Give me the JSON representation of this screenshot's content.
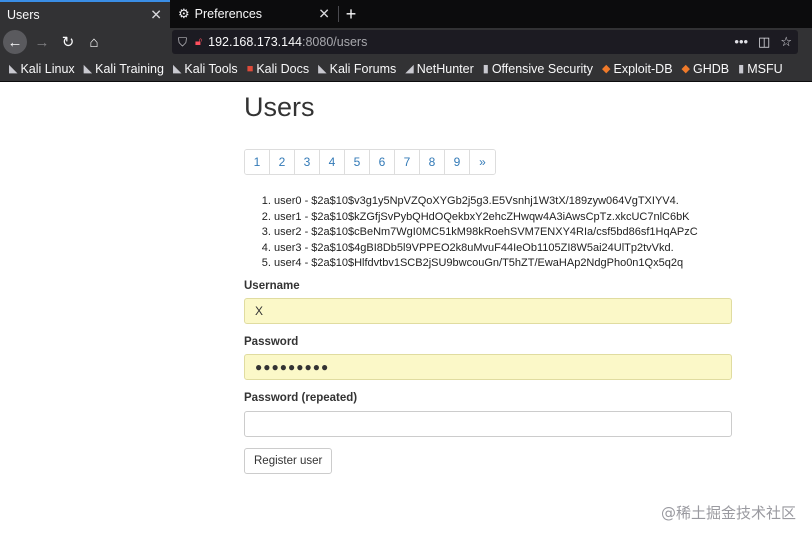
{
  "tabs": [
    {
      "title": "Users",
      "active": true
    },
    {
      "title": "Preferences",
      "active": false
    }
  ],
  "new_tab_label": "+",
  "url": {
    "host": "192.168.173.144",
    "rest": ":8080/users"
  },
  "bookmarks": [
    "Kali Linux",
    "Kali Training",
    "Kali Tools",
    "Kali Docs",
    "Kali Forums",
    "NetHunter",
    "Offensive Security",
    "Exploit-DB",
    "GHDB",
    "MSFU"
  ],
  "page": {
    "title": "Users",
    "pagination": [
      "1",
      "2",
      "3",
      "4",
      "5",
      "6",
      "7",
      "8",
      "9",
      "»"
    ],
    "users": [
      "user0 - $2a$10$v3g1y5NpVZQoXYGb2j5g3.E5Vsnhj1W3tX/189zyw064VgTXIYV4.",
      "user1 - $2a$10$kZGfjSvPybQHdOQekbxY2ehcZHwqw4A3iAwsCpTz.xkcUC7nlC6bK",
      "user2 - $2a$10$cBeNm7WgI0MC51kM98kRoehSVM7ENXY4RIa/csf5bd86sf1HqAPzC",
      "user3 - $2a$10$4gBI8Db5l9VPPEO2k8uMvuF44IeOb1105ZI8W5ai24UlTp2tvVkd.",
      "user4 - $2a$10$Hlfdvtbv1SCB2jSU9bwcouGn/T5hZT/EwaHAp2NdgPho0n1Qx5q2q"
    ],
    "form": {
      "username_label": "Username",
      "username_value": "X",
      "password_label": "Password",
      "password_value": "●●●●●●●●●",
      "password_repeat_label": "Password (repeated)",
      "password_repeat_value": "",
      "submit_label": "Register user"
    }
  },
  "watermark": "@稀土掘金技术社区"
}
